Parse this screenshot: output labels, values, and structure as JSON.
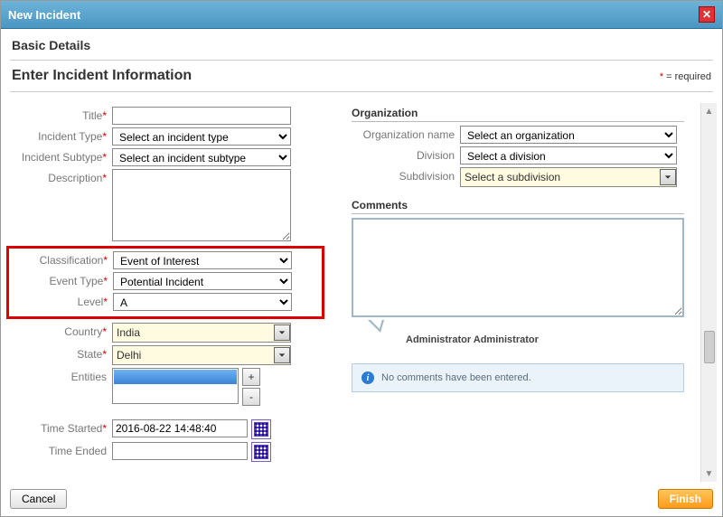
{
  "dialog": {
    "title": "New Incident"
  },
  "section": "Basic Details",
  "subtitle": "Enter Incident Information",
  "required_note": "= required",
  "left": {
    "labels": {
      "title": "Title",
      "incident_type": "Incident Type",
      "incident_subtype": "Incident Subtype",
      "description": "Description",
      "classification": "Classification",
      "event_type": "Event Type",
      "level": "Level",
      "country": "Country",
      "state": "State",
      "entities": "Entities",
      "time_started": "Time Started",
      "time_ended": "Time Ended"
    },
    "values": {
      "title": "",
      "incident_type_selected": "Select an incident type",
      "incident_subtype_selected": "Select an incident subtype",
      "description": "",
      "classification": "Event of Interest",
      "event_type": "Potential Incident",
      "level": "A",
      "country": "India",
      "state": "Delhi",
      "time_started": "2016-08-22 14:48:40",
      "time_ended": ""
    },
    "buttons": {
      "add": "+",
      "remove": "-"
    }
  },
  "right": {
    "org_heading": "Organization",
    "labels": {
      "organization_name": "Organization name",
      "division": "Division",
      "subdivision": "Subdivision"
    },
    "values": {
      "organization_selected": "Select an organization",
      "division_selected": "Select a division",
      "subdivision_selected": "Select a subdivision"
    },
    "comments_heading": "Comments",
    "commenter": "Administrator Administrator",
    "no_comments": "No comments have been entered."
  },
  "footer": {
    "cancel": "Cancel",
    "finish": "Finish"
  }
}
